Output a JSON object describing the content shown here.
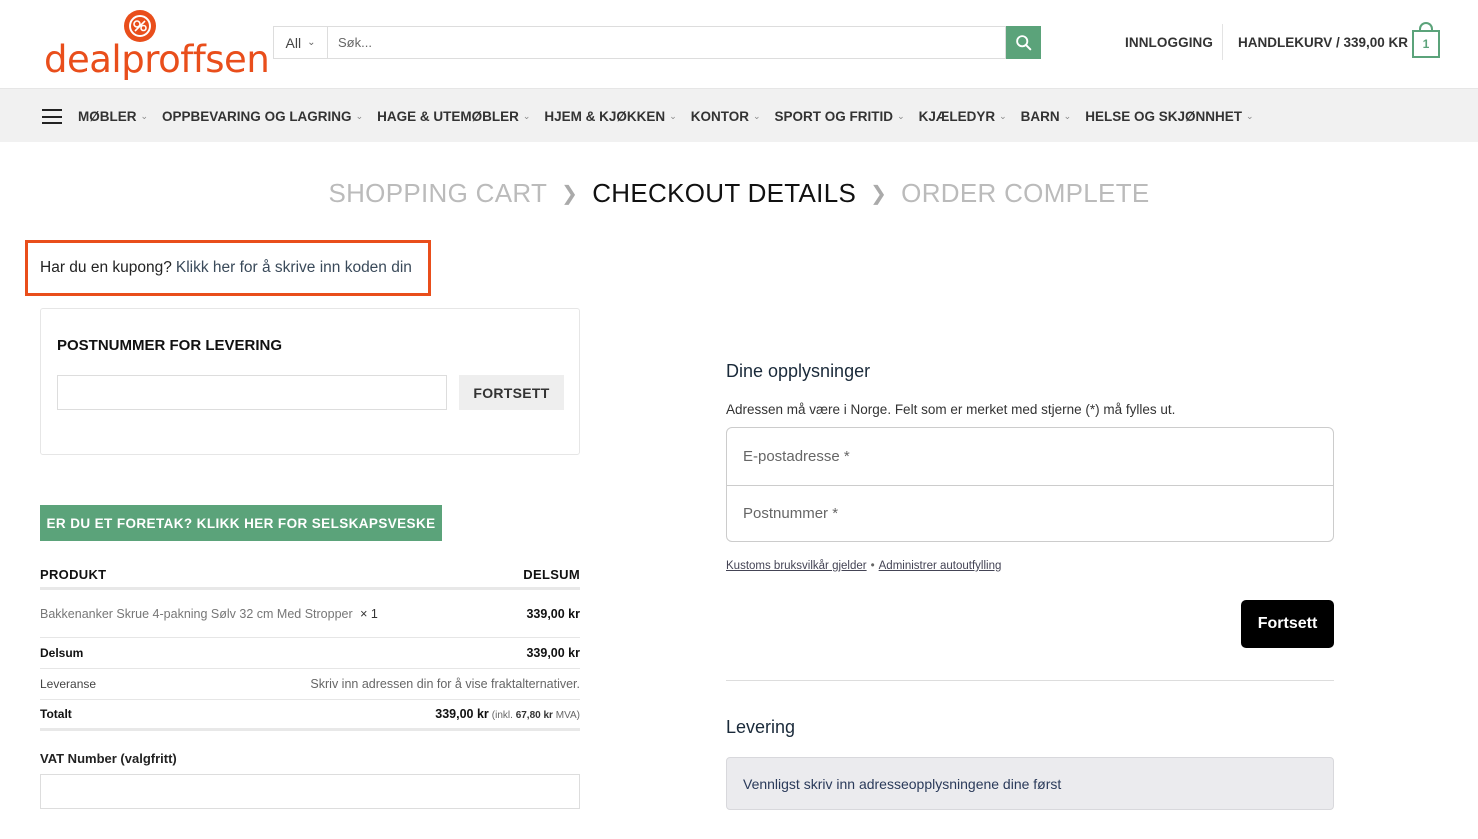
{
  "brand": {
    "name": "dealproffsen",
    "color": "#e94e1b",
    "accent_green": "#5ba37a"
  },
  "search": {
    "category": "All",
    "placeholder": "Søk...",
    "icon": "search-icon"
  },
  "header": {
    "login": "INNLOGGING",
    "cart_label": "HANDLEKURV / 339,00 KR",
    "cart_count": "1"
  },
  "nav": {
    "items": [
      "MØBLER",
      "OPPBEVARING OG LAGRING",
      "HAGE & UTEMØBLER",
      "HJEM & KJØKKEN",
      "KONTOR",
      "SPORT OG FRITID",
      "KJÆLEDYR",
      "BARN",
      "HELSE OG SKJØNNHET"
    ]
  },
  "steps": {
    "cart": "SHOPPING CART",
    "checkout": "CHECKOUT DETAILS",
    "complete": "ORDER COMPLETE"
  },
  "coupon": {
    "question": "Har du en kupong?",
    "link": "Klikk her for å skrive inn koden din"
  },
  "postal": {
    "title": "POSTNUMMER FOR LEVERING",
    "button": "FORTSETT"
  },
  "company_button": "ER DU ET FORETAK? KLIKK HER FOR SELSKAPSVESKE",
  "order": {
    "col_product": "PRODUKT",
    "col_subtotal": "DELSUM",
    "product_name": "Bakkenanker Skrue 4-pakning Sølv 32 cm Med Stropper",
    "product_qty": "× 1",
    "product_price": "339,00 kr",
    "subtotal_label": "Delsum",
    "subtotal_value": "339,00 kr",
    "shipping_label": "Leveranse",
    "shipping_value": "Skriv inn adressen din for å vise fraktalternativer.",
    "total_label": "Totalt",
    "total_value": "339,00 kr",
    "tax_prefix": "(inkl.",
    "tax_amount": "67,80 kr",
    "tax_suffix": "MVA)"
  },
  "vat": {
    "label": "VAT Number (valgfritt)"
  },
  "details": {
    "title": "Dine opplysninger",
    "note": "Adressen må være i Norge. Felt som er merket med stjerne (*) må fylles ut.",
    "email_placeholder": "E-postadresse *",
    "postal_placeholder": "Postnummer *",
    "terms_link": "Kustoms bruksvilkår gjelder",
    "terms_sep": "•",
    "autofill_link": "Administrer autoutfylling",
    "continue": "Fortsett"
  },
  "delivery": {
    "title": "Levering",
    "notice": "Vennligst skriv inn adresseopplysningene dine først"
  }
}
